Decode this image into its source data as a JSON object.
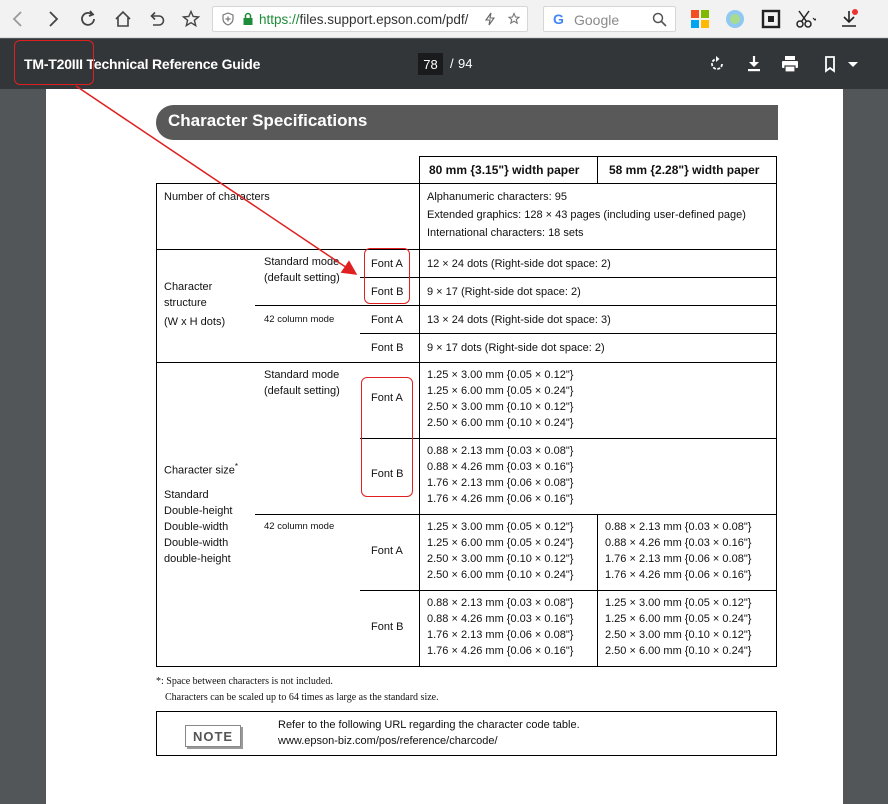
{
  "browser": {
    "url_scheme": "https://",
    "url_rest": "files.support.epson.com/pdf/",
    "search_placeholder": "Google",
    "google_letter": "G"
  },
  "pdf_toolbar": {
    "title": "TM-T20III Technical Reference Guide",
    "current_page": "78",
    "separator": "/",
    "total_pages": "94"
  },
  "section": {
    "title": "Character Specifications"
  },
  "table": {
    "col_headers": [
      "80 mm {3.15\"} width paper",
      "58 mm {2.28\"} width paper"
    ],
    "number_of_characters": {
      "label": "Number of characters",
      "values": [
        "Alphanumeric characters: 95",
        "Extended graphics: 128 × 43 pages (including user-defined page)",
        "International characters: 18 sets"
      ]
    },
    "char_structure": {
      "label": [
        "Character",
        "structure",
        "(W x H dots)"
      ],
      "standard_mode": [
        "Standard mode",
        "(default setting)"
      ],
      "column_mode": "42 column mode",
      "rows": [
        {
          "font": "Font A",
          "value": "12 × 24 dots (Right-side dot space: 2)"
        },
        {
          "font": "Font B",
          "value": "9 × 17 (Right-side dot space: 2)"
        },
        {
          "font": "Font A",
          "value": "13 × 24 dots (Right-side dot space: 3)"
        },
        {
          "font": "Font B",
          "value": "9 × 17 dots (Right-side dot space: 2)"
        }
      ]
    },
    "char_size": {
      "label": "Character size",
      "asterisk": "*",
      "types": [
        "Standard",
        "Double-height",
        "Double-width",
        "Double-width",
        "double-height"
      ],
      "standard_mode": [
        "Standard mode",
        "(default setting)"
      ],
      "column_mode": "42 column mode",
      "std_font_a": {
        "font": "Font A",
        "values": [
          "1.25 × 3.00 mm {0.05 × 0.12\"}",
          "1.25 × 6.00 mm {0.05 × 0.24\"}",
          "2.50 × 3.00 mm {0.10 × 0.12\"}",
          "2.50 × 6.00 mm {0.10 × 0.24\"}"
        ]
      },
      "std_font_b": {
        "font": "Font B",
        "values": [
          "0.88 × 2.13 mm {0.03 × 0.08\"}",
          "0.88 × 4.26 mm {0.03 × 0.16\"}",
          "1.76 × 2.13 mm {0.06 × 0.08\"}",
          "1.76 × 4.26 mm {0.06 × 0.16\"}"
        ]
      },
      "col_font_a": {
        "font": "Font A",
        "values_80": [
          "1.25 × 3.00 mm {0.05 × 0.12\"}",
          "1.25 × 6.00 mm {0.05 × 0.24\"}",
          "2.50 × 3.00 mm {0.10 × 0.12\"}",
          "2.50 × 6.00 mm {0.10 × 0.24\"}"
        ],
        "values_58": [
          "0.88 × 2.13 mm {0.03 × 0.08\"}",
          "0.88 × 4.26 mm {0.03 × 0.16\"}",
          "1.76 × 2.13 mm {0.06 × 0.08\"}",
          "1.76 × 4.26 mm {0.06 × 0.16\"}"
        ]
      },
      "col_font_b": {
        "font": "Font B",
        "values_80": [
          "0.88 × 2.13 mm {0.03 × 0.08\"}",
          "0.88 × 4.26 mm {0.03 × 0.16\"}",
          "1.76 × 2.13 mm {0.06 × 0.08\"}",
          "1.76 × 4.26 mm {0.06 × 0.16\"}"
        ],
        "values_58": [
          "1.25 × 3.00 mm {0.05 × 0.12\"}",
          "1.25 × 6.00 mm {0.05 × 0.24\"}",
          "2.50 × 3.00 mm {0.10 × 0.12\"}",
          "2.50 × 6.00 mm {0.10 × 0.24\"}"
        ]
      }
    }
  },
  "footnotes": [
    "*: Space between characters is not included.",
    "Characters can be scaled up to 64 times as large as the standard size."
  ],
  "note": {
    "badge": "NOTE",
    "lines": [
      "Refer to the following URL regarding the character code table.",
      "www.epson-biz.com/pos/reference/charcode/"
    ]
  },
  "annotation_color": "#e02020"
}
